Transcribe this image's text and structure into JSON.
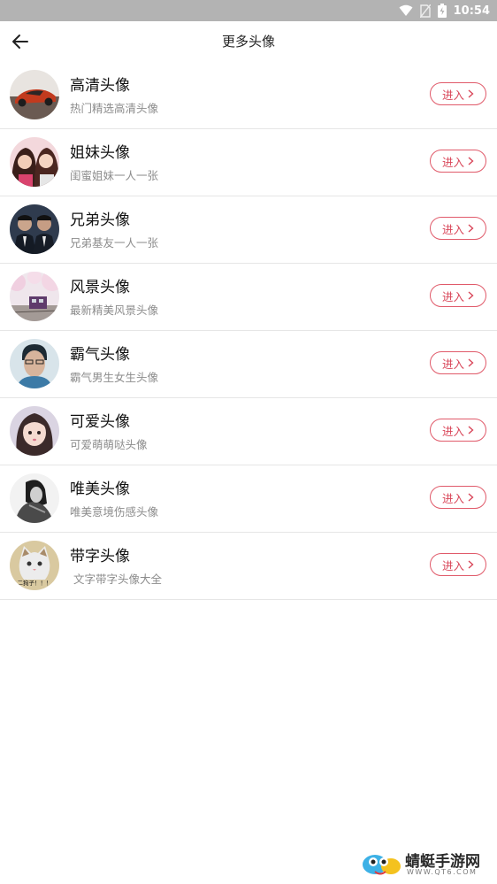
{
  "status_bar": {
    "time": "10:54",
    "icons": [
      "wifi-icon",
      "no-sim-icon",
      "battery-icon"
    ]
  },
  "header": {
    "title": "更多头像",
    "back_icon": "back-arrow-icon"
  },
  "items": [
    {
      "title": "高清头像",
      "subtitle": "热门精选高清头像",
      "button": "进入",
      "avatar": "sports-car-avatar"
    },
    {
      "title": "姐妹头像",
      "subtitle": "闺蜜姐妹一人一张",
      "button": "进入",
      "avatar": "two-girls-avatar"
    },
    {
      "title": "兄弟头像",
      "subtitle": "兄弟基友一人一张",
      "button": "进入",
      "avatar": "two-men-avatar"
    },
    {
      "title": "风景头像",
      "subtitle": "最新精美风景头像",
      "button": "进入",
      "avatar": "cherry-blossom-train-avatar"
    },
    {
      "title": "霸气头像",
      "subtitle": "霸气男生女生头像",
      "button": "进入",
      "avatar": "man-portrait-avatar"
    },
    {
      "title": "可爱头像",
      "subtitle": "可爱萌萌哒头像",
      "button": "进入",
      "avatar": "cute-girl-avatar"
    },
    {
      "title": "唯美头像",
      "subtitle": "唯美意境伤感头像",
      "button": "进入",
      "avatar": "bw-girl-avatar"
    },
    {
      "title": "带字头像",
      "subtitle": "文字带字头像大全",
      "button": "进入",
      "avatar": "cat-text-avatar",
      "avatar_text": "二狗子！！！"
    }
  ],
  "watermark": {
    "title": "蜻蜓手游网",
    "url": "WWW.QT6.COM"
  },
  "colors": {
    "accent": "#e05a6a",
    "status_bar": "#b3b3b3",
    "divider": "#e6e6e6",
    "subtitle": "#8c8c8c"
  }
}
